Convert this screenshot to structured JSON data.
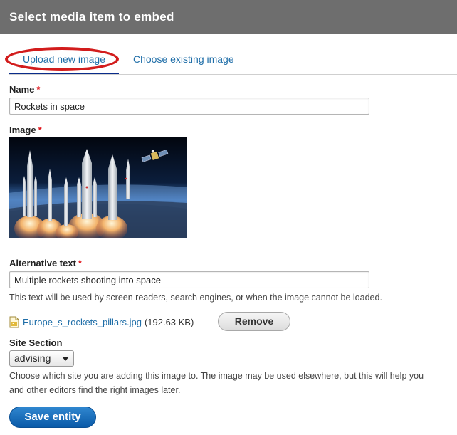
{
  "dialog": {
    "title": "Select media item to embed"
  },
  "tabs": [
    {
      "label": "Upload new image",
      "active": true
    },
    {
      "label": "Choose existing image",
      "active": false
    }
  ],
  "form": {
    "name": {
      "label": "Name",
      "required_mark": "*",
      "value": "Rockets in space"
    },
    "image": {
      "label": "Image",
      "required_mark": "*"
    },
    "alt_text": {
      "label": "Alternative text",
      "required_mark": "*",
      "value": "Multiple rockets shooting into space",
      "description": "This text will be used by screen readers, search engines, or when the image cannot be loaded."
    },
    "file": {
      "icon": "image-file-icon",
      "name": "Europe_s_rockets_pillars.jpg",
      "size": "(192.63 KB)",
      "remove_label": "Remove"
    },
    "site_section": {
      "label": "Site Section",
      "selected": "advising",
      "description_line1": "Choose which site you are adding this image to. The image may be used elsewhere, but this will help you",
      "description_line2": "and other editors find the right images later."
    },
    "save_label": "Save entity"
  },
  "colors": {
    "title_bar": "#6e6e6e",
    "link": "#1f6ea8",
    "required": "#e0131a",
    "highlight_ellipse": "#d21c1c",
    "primary_button": "#0a5aa8"
  }
}
